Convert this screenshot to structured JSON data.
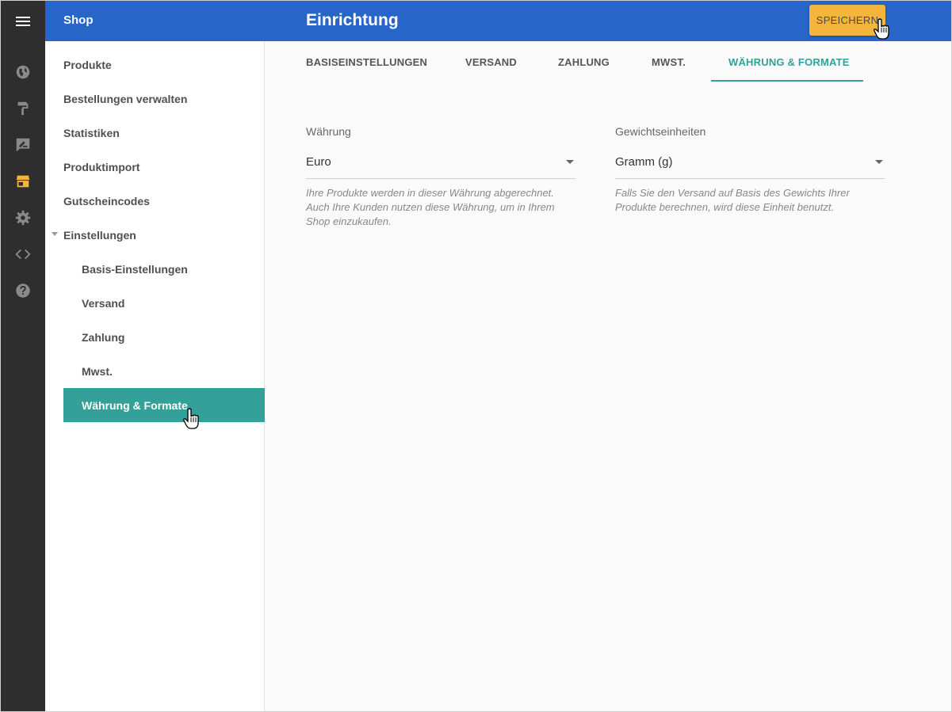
{
  "header": {
    "section": "Shop",
    "title": "Einrichtung",
    "save_label": "SPEICHERN"
  },
  "rail": {
    "icons": [
      "menu-icon",
      "globe-icon",
      "paint-roller-icon",
      "edit-note-icon",
      "store-icon",
      "gear-icon",
      "code-icon",
      "help-icon"
    ],
    "active_color": "#f5b43b"
  },
  "sidebar": {
    "items": [
      {
        "label": "Produkte"
      },
      {
        "label": "Bestellungen verwalten"
      },
      {
        "label": "Statistiken"
      },
      {
        "label": "Produktimport"
      },
      {
        "label": "Gutscheincodes"
      },
      {
        "label": "Einstellungen"
      }
    ],
    "subitems": [
      {
        "label": "Basis-Einstellungen"
      },
      {
        "label": "Versand"
      },
      {
        "label": "Zahlung"
      },
      {
        "label": "Mwst."
      },
      {
        "label": "Währung & Formate"
      }
    ]
  },
  "tabs": [
    {
      "label": "BASISEINSTELLUNGEN"
    },
    {
      "label": "VERSAND"
    },
    {
      "label": "ZAHLUNG"
    },
    {
      "label": "MWST."
    },
    {
      "label": "WÄHRUNG & FORMATE"
    }
  ],
  "form": {
    "currency": {
      "label": "Währung",
      "value": "Euro",
      "hint": "Ihre Produkte werden in dieser Währung abgerechnet. Auch Ihre Kunden nutzen diese Währung, um in Ihrem Shop einzukaufen."
    },
    "weight": {
      "label": "Gewichtseinheiten",
      "value": "Gramm (g)",
      "hint": "Falls Sie den Versand auf Basis des Gewichts Ihrer Produkte berechnen, wird diese Einheit benutzt."
    }
  },
  "colors": {
    "header_blue": "#2765c8",
    "accent_teal": "#33a199",
    "save_orange": "#f5b43b",
    "rail_dark": "#2e2e2e"
  }
}
